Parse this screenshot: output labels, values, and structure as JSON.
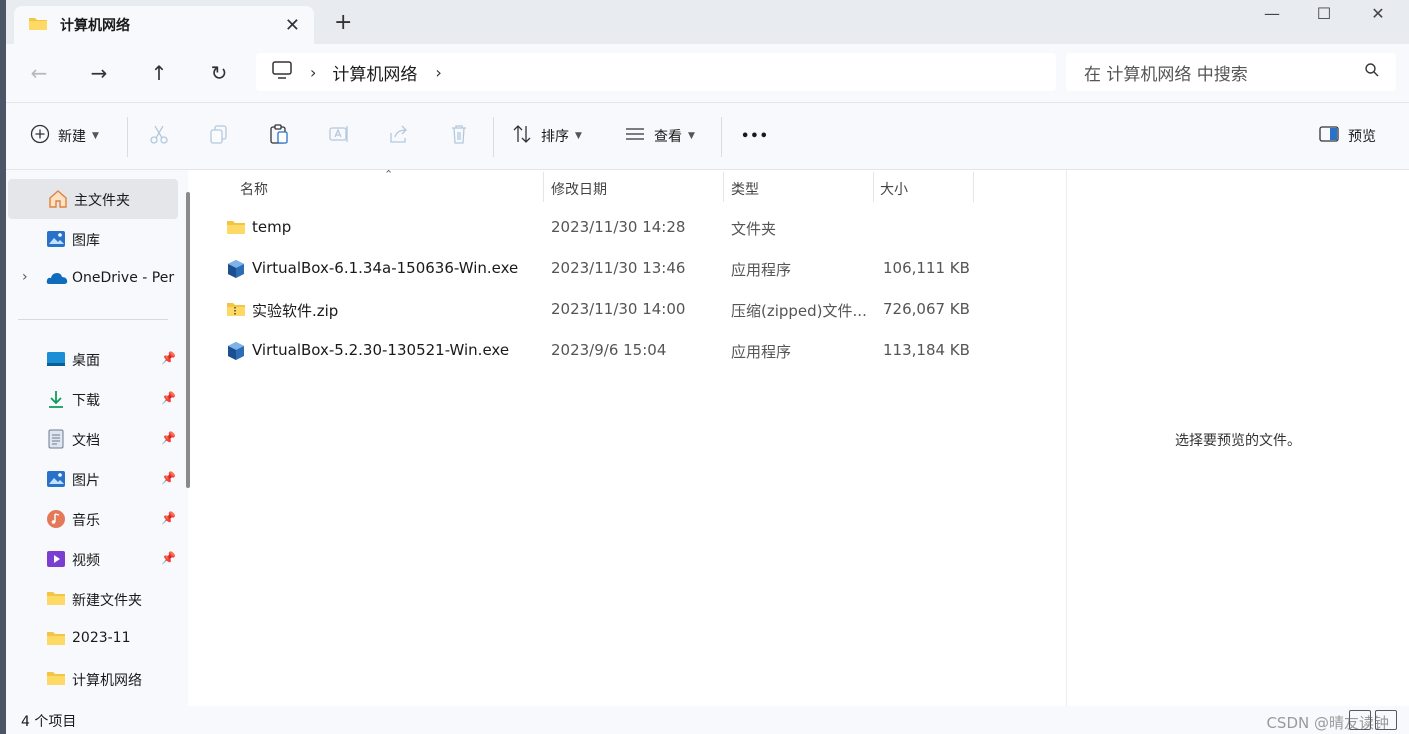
{
  "tab": {
    "title": "计算机网络",
    "close_icon": "close-icon",
    "new_tab_label": "+"
  },
  "window_controls": {
    "minimize": "—",
    "maximize": "☐",
    "close": "✕"
  },
  "nav": {
    "back": "←",
    "forward": "→",
    "up": "↑",
    "refresh": "↻"
  },
  "address": {
    "separator": "›",
    "path": "计算机网络",
    "trailing_separator": "›"
  },
  "search": {
    "placeholder": "在 计算机网络 中搜索"
  },
  "commands": {
    "new_label": "新建",
    "sort_label": "排序",
    "view_label": "查看",
    "more_label": "•••",
    "preview_label": "预览"
  },
  "sidebar": {
    "items": [
      {
        "label": "主文件夹",
        "icon": "home-icon"
      },
      {
        "label": "图库",
        "icon": "gallery-icon"
      },
      {
        "label": "OneDrive - Per",
        "icon": "onedrive-icon"
      },
      {
        "label": "桌面",
        "icon": "desktop-icon"
      },
      {
        "label": "下载",
        "icon": "download-icon"
      },
      {
        "label": "文档",
        "icon": "document-icon"
      },
      {
        "label": "图片",
        "icon": "pictures-icon"
      },
      {
        "label": "音乐",
        "icon": "music-icon"
      },
      {
        "label": "视频",
        "icon": "video-icon"
      },
      {
        "label": "新建文件夹",
        "icon": "folder-icon"
      },
      {
        "label": "2023-11",
        "icon": "folder-icon"
      },
      {
        "label": "计算机网络",
        "icon": "folder-icon"
      }
    ],
    "expand_glyph": "›",
    "pin_glyph": "📌"
  },
  "columns": {
    "name": "名称",
    "date": "修改日期",
    "type": "类型",
    "size": "大小",
    "sort_glyph": "⌃"
  },
  "files": [
    {
      "name": "temp",
      "date": "2023/11/30 14:28",
      "type": "文件夹",
      "size": "",
      "icon": "folder-icon"
    },
    {
      "name": "VirtualBox-6.1.34a-150636-Win.exe",
      "date": "2023/11/30 13:46",
      "type": "应用程序",
      "size": "106,111 KB",
      "icon": "virtualbox-icon"
    },
    {
      "name": "实验软件.zip",
      "date": "2023/11/30 14:00",
      "type": "压缩(zipped)文件...",
      "size": "726,067 KB",
      "icon": "zip-folder-icon"
    },
    {
      "name": "VirtualBox-5.2.30-130521-Win.exe",
      "date": "2023/9/6 15:04",
      "type": "应用程序",
      "size": "113,184 KB",
      "icon": "virtualbox-icon"
    }
  ],
  "preview": {
    "message": "选择要预览的文件。"
  },
  "status": {
    "count": "4 个项目"
  },
  "watermark": "CSDN @晴友读钟"
}
